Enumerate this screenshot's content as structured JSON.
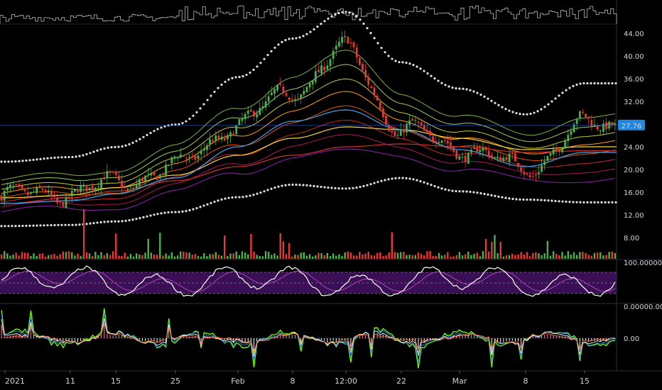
{
  "colors": {
    "background": "#000000",
    "up": "#26a69a",
    "down": "#ef5350",
    "green_candle": "#4caf50",
    "red_candle": "#e53935",
    "price_line": "#2962ff",
    "price_badge": "#1e88e5",
    "envelope_dots": "#e0e0e0",
    "rsi_band": "#6a1b9a",
    "rsi_line": "#ffffff",
    "rsi_signal": "#ab47bc",
    "ma_red": "#d32f2f",
    "ma_yellow": "#fdd835",
    "ma_blue": "#42a5f5",
    "osc_green": "#76ff03"
  },
  "price_scale": {
    "ticks": [
      "44.00",
      "40.00",
      "36.00",
      "32.00",
      "28.00",
      "24.00",
      "20.00",
      "16.00",
      "12.00",
      "8.00"
    ],
    "current_price": "27.76"
  },
  "rsi_scale": {
    "top_label": "100.00000"
  },
  "osc_scale": {
    "top_label": "0.00000.00",
    "zero_label": "0.00"
  },
  "time_axis": {
    "labels": [
      "2021",
      "11",
      "15",
      "25",
      "Feb",
      "8",
      "12:00",
      "22",
      "Mar",
      "8",
      "15"
    ]
  },
  "chart_data": {
    "type": "line",
    "panes": [
      "volume-top",
      "price",
      "volume",
      "rsi",
      "oscillator"
    ],
    "x": [
      "2021",
      "11",
      "15",
      "25",
      "Feb",
      "8",
      "12:00",
      "22",
      "Mar",
      "8",
      "15"
    ],
    "close": [
      15.2,
      16.0,
      17.5,
      20.5,
      28.0,
      34.0,
      41.0,
      27.0,
      24.0,
      20.0,
      27.76
    ],
    "ma_slow": [
      14.0,
      15.0,
      16.2,
      18.0,
      20.5,
      22.5,
      24.0,
      24.5,
      24.0,
      23.0,
      23.3
    ],
    "ma_mid": [
      15.0,
      15.5,
      16.8,
      19.0,
      22.5,
      25.5,
      27.5,
      27.0,
      25.5,
      23.5,
      24.0
    ],
    "ma_fast": [
      15.5,
      16.0,
      17.2,
      20.0,
      25.5,
      30.0,
      32.0,
      28.5,
      25.0,
      22.0,
      24.5
    ],
    "ylim": [
      8,
      46
    ]
  }
}
